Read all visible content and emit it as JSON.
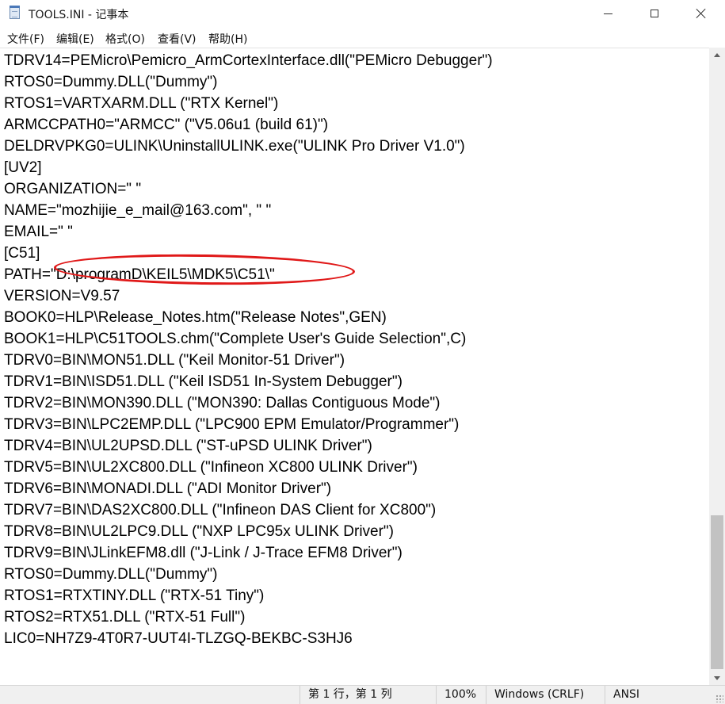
{
  "window": {
    "title": "TOOLS.INI - 记事本",
    "icon": "notepad-icon"
  },
  "menu": [
    {
      "label": "文件(F)"
    },
    {
      "label": "编辑(E)"
    },
    {
      "label": "格式(O)"
    },
    {
      "label": "查看(V)"
    },
    {
      "label": "帮助(H)"
    }
  ],
  "editor": {
    "lines": [
      "TDRV14=PEMicro\\Pemicro_ArmCortexInterface.dll(\"PEMicro Debugger\")",
      "RTOS0=Dummy.DLL(\"Dummy\")",
      "RTOS1=VARTXARM.DLL (\"RTX Kernel\")",
      "ARMCCPATH0=\"ARMCC\" (\"V5.06u1 (build 61)\")",
      "DELDRVPKG0=ULINK\\UninstallULINK.exe(\"ULINK Pro Driver V1.0\")",
      "[UV2]",
      "ORGANIZATION=\" \"",
      "NAME=\"mozhijie_e_mail@163.com\", \" \"",
      "EMAIL=\" \"",
      "[C51]",
      "PATH=\"D:\\programD\\KEIL5\\MDK5\\C51\\\"",
      "VERSION=V9.57",
      "BOOK0=HLP\\Release_Notes.htm(\"Release Notes\",GEN)",
      "BOOK1=HLP\\C51TOOLS.chm(\"Complete User's Guide Selection\",C)",
      "TDRV0=BIN\\MON51.DLL (\"Keil Monitor-51 Driver\")",
      "TDRV1=BIN\\ISD51.DLL (\"Keil ISD51 In-System Debugger\")",
      "TDRV2=BIN\\MON390.DLL (\"MON390: Dallas Contiguous Mode\")",
      "TDRV3=BIN\\LPC2EMP.DLL (\"LPC900 EPM Emulator/Programmer\")",
      "TDRV4=BIN\\UL2UPSD.DLL (\"ST-uPSD ULINK Driver\")",
      "TDRV5=BIN\\UL2XC800.DLL (\"Infineon XC800 ULINK Driver\")",
      "TDRV6=BIN\\MONADI.DLL (\"ADI Monitor Driver\")",
      "TDRV7=BIN\\DAS2XC800.DLL (\"Infineon DAS Client for XC800\")",
      "TDRV8=BIN\\UL2LPC9.DLL (\"NXP LPC95x ULINK Driver\")",
      "TDRV9=BIN\\JLinkEFM8.dll (\"J-Link / J-Trace EFM8 Driver\")",
      "RTOS0=Dummy.DLL(\"Dummy\")",
      "RTOS1=RTXTINY.DLL (\"RTX-51 Tiny\")",
      "RTOS2=RTX51.DLL (\"RTX-51 Full\")",
      "LIC0=NH7Z9-4T0R7-UUT4I-TLZGQ-BEKBC-S3HJ6"
    ],
    "highlight_color": "#e01818"
  },
  "status": {
    "position": "第 1 行，第 1 列",
    "zoom": "100%",
    "line_ending": "Windows (CRLF)",
    "encoding": "ANSI"
  }
}
